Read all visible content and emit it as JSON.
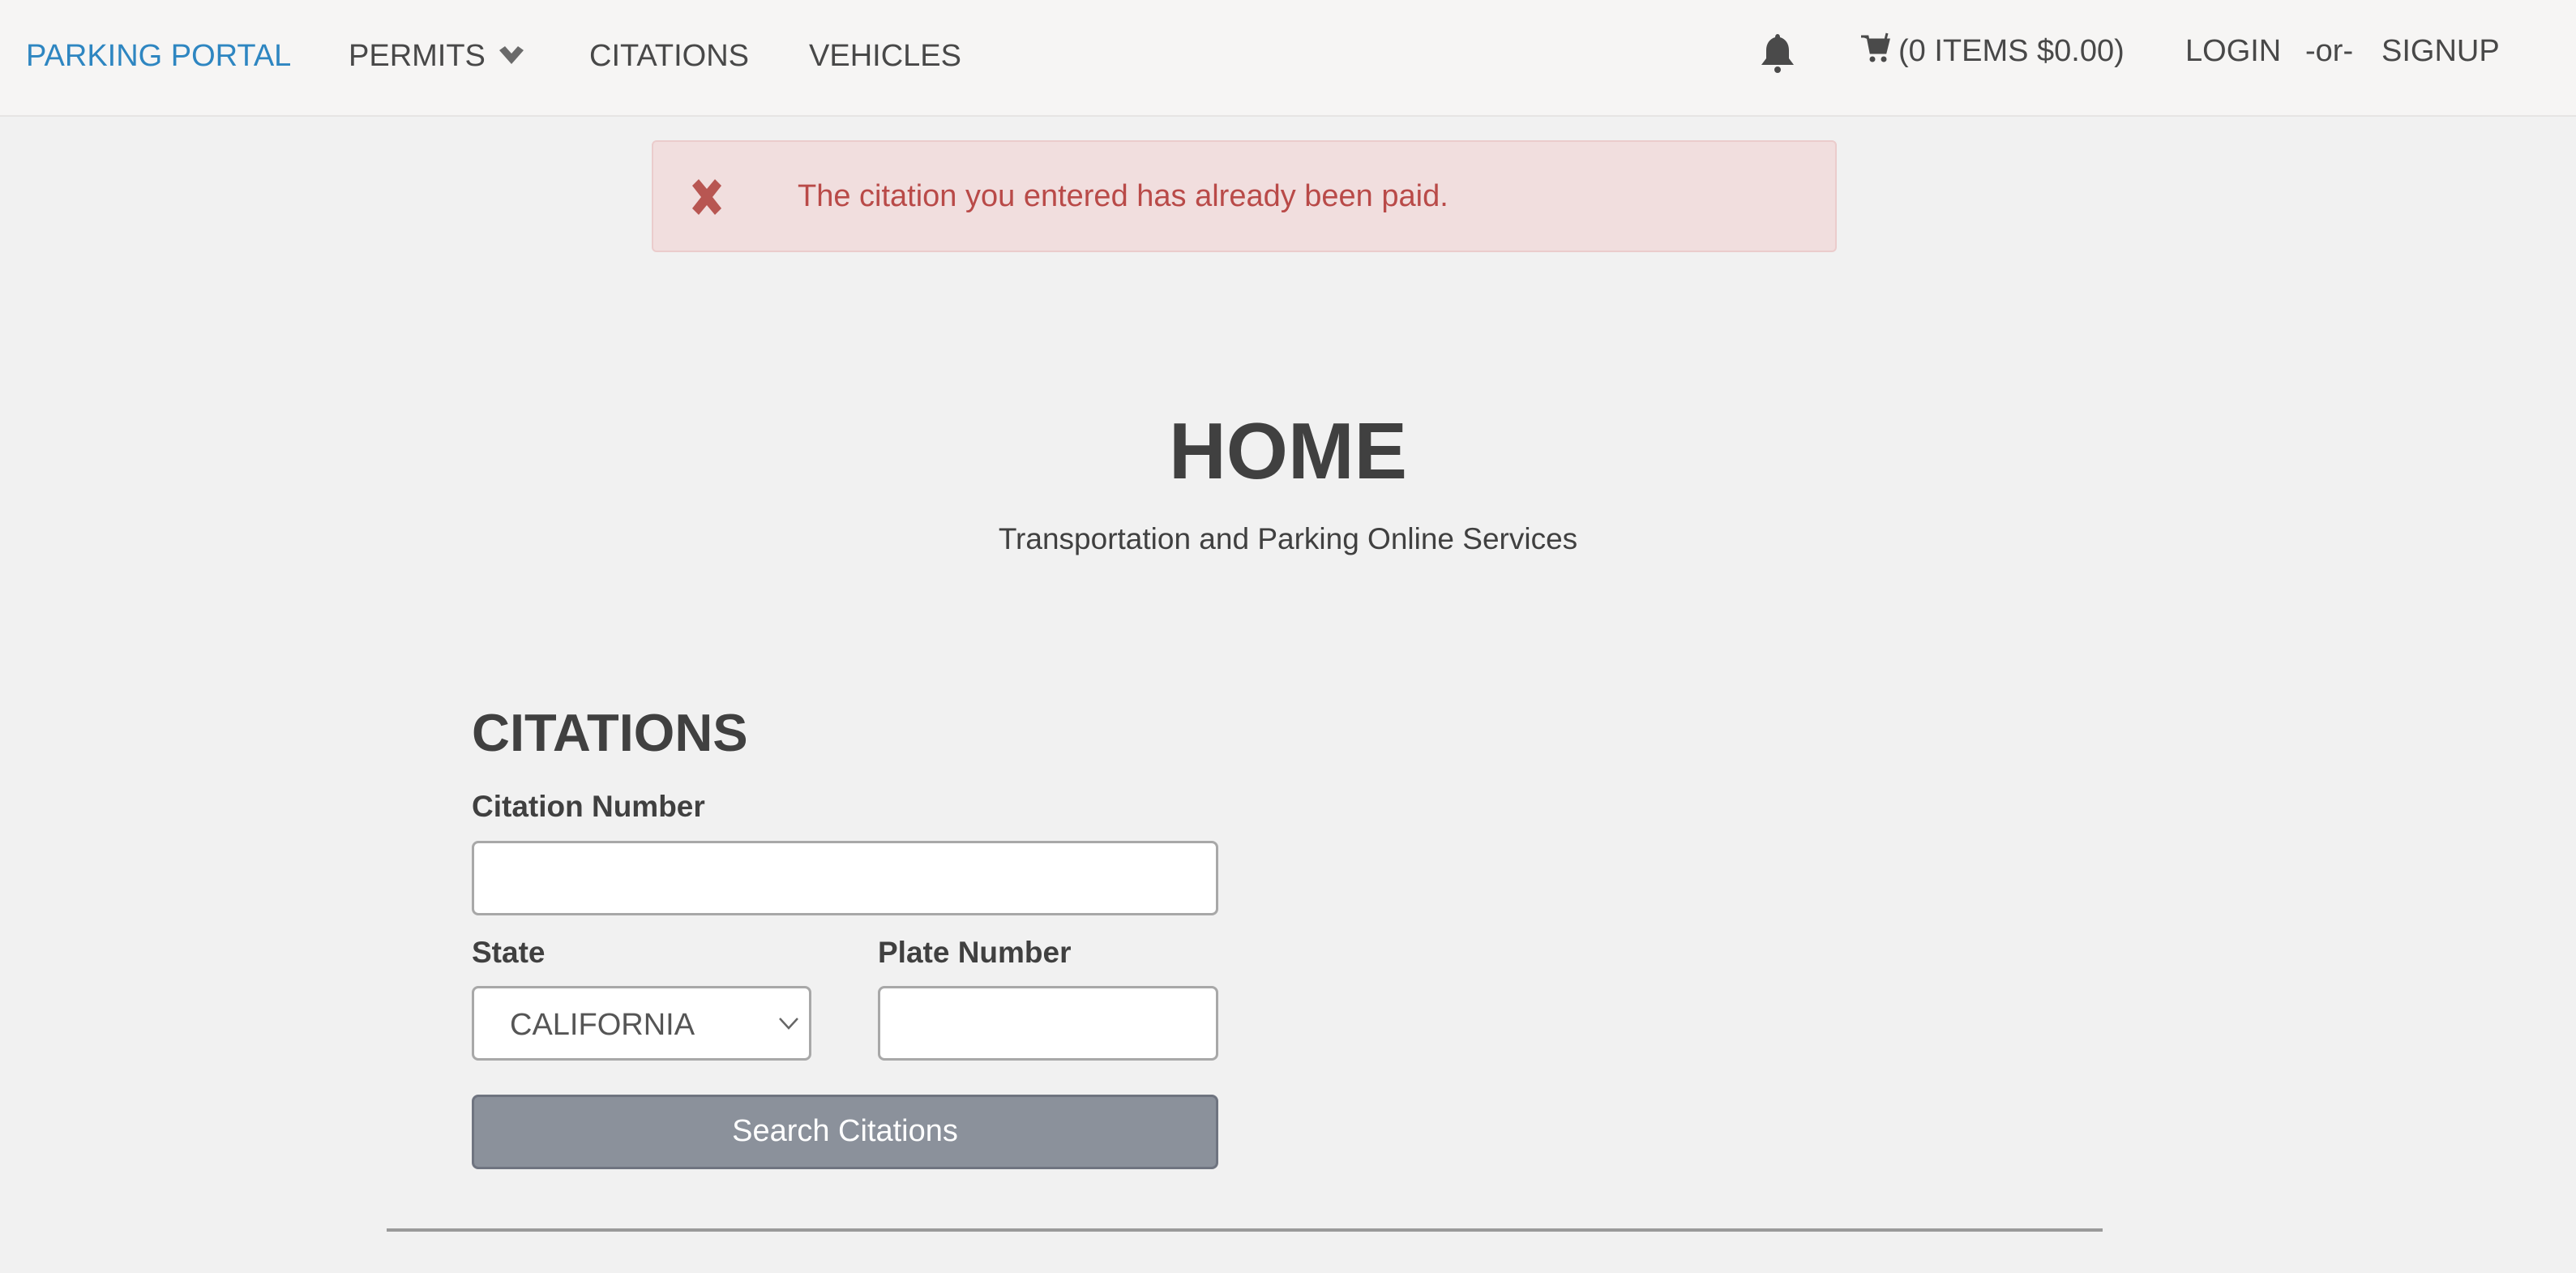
{
  "navbar": {
    "brand": "PARKING PORTAL",
    "items": [
      {
        "label": "PERMITS",
        "icon": "chevron-down-icon"
      },
      {
        "label": "CITATIONS"
      },
      {
        "label": "VEHICLES"
      }
    ],
    "notifications_icon": "bell-icon",
    "cart": {
      "icon": "cart-icon",
      "label": "(0 ITEMS $0.00)"
    },
    "login": "LOGIN",
    "separator": "-or-",
    "signup": "SIGNUP"
  },
  "alert": {
    "icon": "close-icon",
    "message": "The citation you entered has already been paid.",
    "color": "#b94a48",
    "background": "#f1dede"
  },
  "page": {
    "title": "HOME",
    "subtitle": "Transportation and Parking Online Services"
  },
  "citations_form": {
    "heading": "CITATIONS",
    "citation_number": {
      "label": "Citation Number",
      "value": "",
      "placeholder": ""
    },
    "state": {
      "label": "State",
      "selected": "CALIFORNIA"
    },
    "plate_number": {
      "label": "Plate Number",
      "value": "",
      "placeholder": ""
    },
    "submit_label": "Search Citations"
  },
  "colors": {
    "brand": "#2e86c1",
    "button": "#8b919b",
    "background": "#f1f1f1"
  }
}
